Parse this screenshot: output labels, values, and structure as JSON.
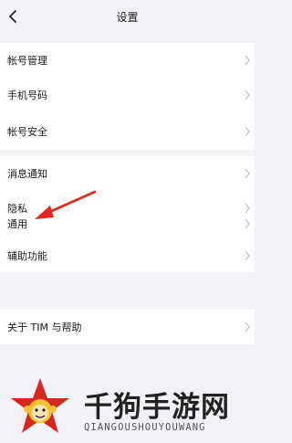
{
  "header": {
    "title": "设置",
    "back_icon": "chevron-left-icon"
  },
  "groups": [
    {
      "items": [
        {
          "label": "帐号管理"
        },
        {
          "label": "手机号码"
        },
        {
          "label": "帐号安全"
        }
      ]
    },
    {
      "items": [
        {
          "label": "消息通知"
        },
        {
          "label": "隐私"
        },
        {
          "label": "通用"
        },
        {
          "label": "辅助功能"
        }
      ]
    },
    {
      "items": [
        {
          "label": "关于 TIM 与帮助"
        }
      ]
    }
  ],
  "annotation": {
    "icon": "red-arrow-icon",
    "color": "#e0261e"
  },
  "watermark": {
    "title": "千狗手游网",
    "subtitle": "QIANGOUSHOUYOUWANG"
  },
  "colors": {
    "background": "#f2f3f6",
    "row_background": "#ffffff",
    "chevron": "#c4c4c8",
    "annotation_red": "#e0261e"
  }
}
